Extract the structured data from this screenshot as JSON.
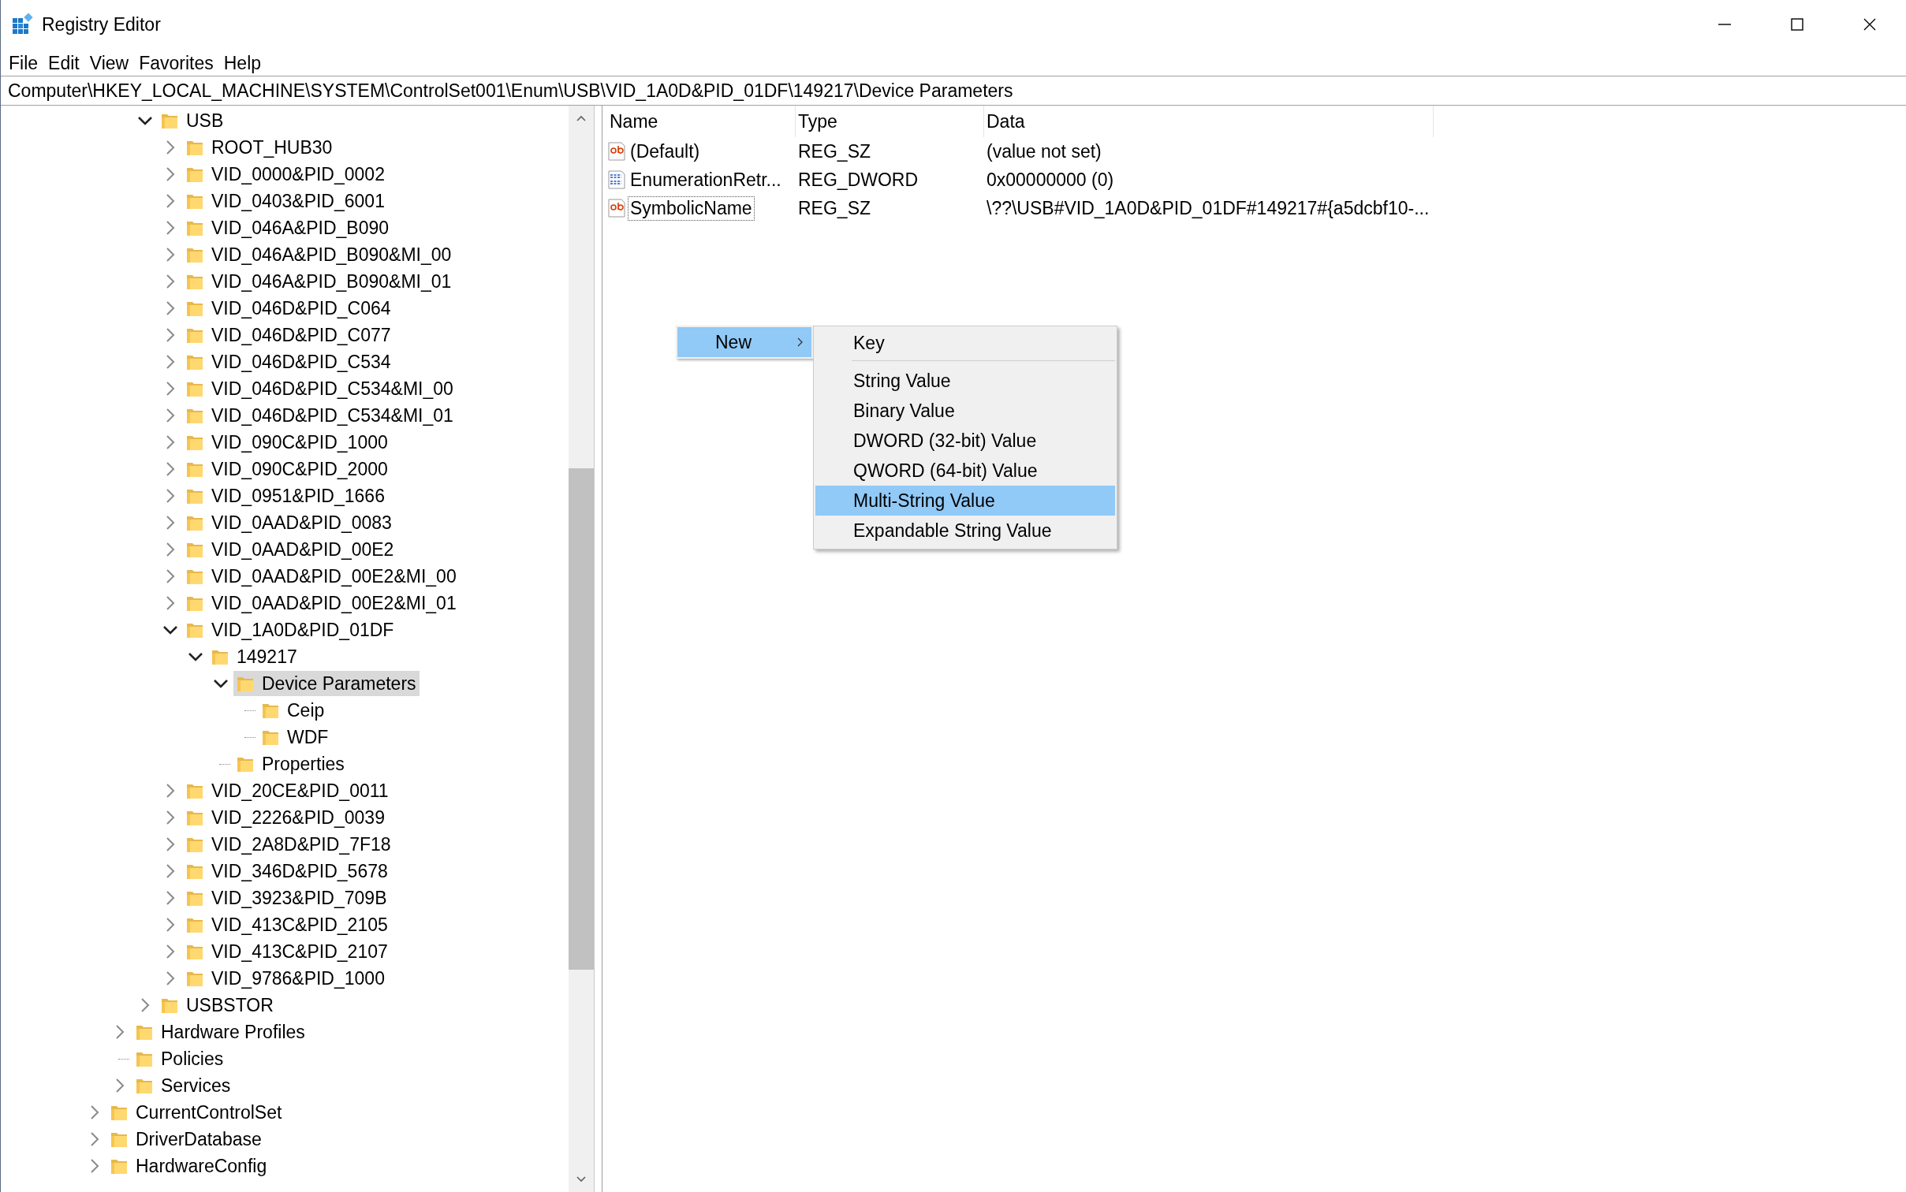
{
  "window": {
    "title": "Registry Editor"
  },
  "menu_bar": [
    "File",
    "Edit",
    "View",
    "Favorites",
    "Help"
  ],
  "address_bar": {
    "value": "Computer\\HKEY_LOCAL_MACHINE\\SYSTEM\\ControlSet001\\Enum\\USB\\VID_1A0D&PID_01DF\\149217\\Device Parameters"
  },
  "tree": {
    "items": [
      {
        "kind": "hidden",
        "children": [
          {
            "kind": "hidden",
            "children": [
              {
                "label": "USB",
                "kind": "branch",
                "expanded": true,
                "selected": false,
                "children": [
                  {
                    "label": "ROOT_HUB30",
                    "kind": "branch",
                    "expanded": false,
                    "selected": false
                  },
                  {
                    "label": "VID_0000&PID_0002",
                    "kind": "branch",
                    "expanded": false,
                    "selected": false
                  },
                  {
                    "label": "VID_0403&PID_6001",
                    "kind": "branch",
                    "expanded": false,
                    "selected": false
                  },
                  {
                    "label": "VID_046A&PID_B090",
                    "kind": "branch",
                    "expanded": false,
                    "selected": false
                  },
                  {
                    "label": "VID_046A&PID_B090&MI_00",
                    "kind": "branch",
                    "expanded": false,
                    "selected": false
                  },
                  {
                    "label": "VID_046A&PID_B090&MI_01",
                    "kind": "branch",
                    "expanded": false,
                    "selected": false
                  },
                  {
                    "label": "VID_046D&PID_C064",
                    "kind": "branch",
                    "expanded": false,
                    "selected": false
                  },
                  {
                    "label": "VID_046D&PID_C077",
                    "kind": "branch",
                    "expanded": false,
                    "selected": false
                  },
                  {
                    "label": "VID_046D&PID_C534",
                    "kind": "branch",
                    "expanded": false,
                    "selected": false
                  },
                  {
                    "label": "VID_046D&PID_C534&MI_00",
                    "kind": "branch",
                    "expanded": false,
                    "selected": false
                  },
                  {
                    "label": "VID_046D&PID_C534&MI_01",
                    "kind": "branch",
                    "expanded": false,
                    "selected": false
                  },
                  {
                    "label": "VID_090C&PID_1000",
                    "kind": "branch",
                    "expanded": false,
                    "selected": false
                  },
                  {
                    "label": "VID_090C&PID_2000",
                    "kind": "branch",
                    "expanded": false,
                    "selected": false
                  },
                  {
                    "label": "VID_0951&PID_1666",
                    "kind": "branch",
                    "expanded": false,
                    "selected": false
                  },
                  {
                    "label": "VID_0AAD&PID_0083",
                    "kind": "branch",
                    "expanded": false,
                    "selected": false
                  },
                  {
                    "label": "VID_0AAD&PID_00E2",
                    "kind": "branch",
                    "expanded": false,
                    "selected": false
                  },
                  {
                    "label": "VID_0AAD&PID_00E2&MI_00",
                    "kind": "branch",
                    "expanded": false,
                    "selected": false
                  },
                  {
                    "label": "VID_0AAD&PID_00E2&MI_01",
                    "kind": "branch",
                    "expanded": false,
                    "selected": false
                  },
                  {
                    "label": "VID_1A0D&PID_01DF",
                    "kind": "branch",
                    "expanded": true,
                    "selected": false,
                    "children": [
                      {
                        "label": "149217",
                        "kind": "branch",
                        "expanded": true,
                        "selected": false,
                        "children": [
                          {
                            "label": "Device Parameters",
                            "kind": "branch",
                            "expanded": true,
                            "selected": true,
                            "children": [
                              {
                                "label": "Ceip",
                                "kind": "leaf",
                                "selected": false
                              },
                              {
                                "label": "WDF",
                                "kind": "leaf",
                                "selected": false
                              }
                            ]
                          },
                          {
                            "label": "Properties",
                            "kind": "leaf",
                            "selected": false
                          }
                        ]
                      }
                    ]
                  },
                  {
                    "label": "VID_20CE&PID_0011",
                    "kind": "branch",
                    "expanded": false,
                    "selected": false
                  },
                  {
                    "label": "VID_2226&PID_0039",
                    "kind": "branch",
                    "expanded": false,
                    "selected": false
                  },
                  {
                    "label": "VID_2A8D&PID_7F18",
                    "kind": "branch",
                    "expanded": false,
                    "selected": false
                  },
                  {
                    "label": "VID_346D&PID_5678",
                    "kind": "branch",
                    "expanded": false,
                    "selected": false
                  },
                  {
                    "label": "VID_3923&PID_709B",
                    "kind": "branch",
                    "expanded": false,
                    "selected": false
                  },
                  {
                    "label": "VID_413C&PID_2105",
                    "kind": "branch",
                    "expanded": false,
                    "selected": false
                  },
                  {
                    "label": "VID_413C&PID_2107",
                    "kind": "branch",
                    "expanded": false,
                    "selected": false
                  },
                  {
                    "label": "VID_9786&PID_1000",
                    "kind": "branch",
                    "expanded": false,
                    "selected": false
                  }
                ]
              },
              {
                "label": "USBSTOR",
                "kind": "branch",
                "expanded": false,
                "selected": false
              }
            ]
          },
          {
            "label": "Hardware Profiles",
            "kind": "branch",
            "expanded": false,
            "selected": false
          },
          {
            "label": "Policies",
            "kind": "leaf",
            "selected": false
          },
          {
            "label": "Services",
            "kind": "branch",
            "expanded": false,
            "selected": false
          }
        ]
      },
      {
        "label": "CurrentControlSet",
        "kind": "branch",
        "expanded": false,
        "selected": false
      },
      {
        "label": "DriverDatabase",
        "kind": "branch",
        "expanded": false,
        "selected": false
      },
      {
        "label": "HardwareConfig",
        "kind": "branch",
        "expanded": false,
        "selected": false
      }
    ]
  },
  "values": {
    "columns": [
      "Name",
      "Type",
      "Data"
    ],
    "rows": [
      {
        "kind": "string",
        "name": "(Default)",
        "type": "REG_SZ",
        "data": "(value not set)",
        "focused": false
      },
      {
        "kind": "binary",
        "name": "EnumerationRetr...",
        "type": "REG_DWORD",
        "data": "0x00000000 (0)",
        "focused": false
      },
      {
        "kind": "string",
        "name": "SymbolicName",
        "type": "REG_SZ",
        "data": "\\??\\USB#VID_1A0D&PID_01DF#149217#{a5dcbf10-...",
        "focused": true
      }
    ]
  },
  "context_menu": {
    "items": [
      {
        "label": "New",
        "selected": true
      }
    ],
    "submenu": [
      {
        "kind": "item",
        "label": "Key",
        "selected": false
      },
      {
        "kind": "separator"
      },
      {
        "kind": "item",
        "label": "String Value",
        "selected": false
      },
      {
        "kind": "item",
        "label": "Binary Value",
        "selected": false
      },
      {
        "kind": "item",
        "label": "DWORD (32-bit) Value",
        "selected": false
      },
      {
        "kind": "item",
        "label": "QWORD (64-bit) Value",
        "selected": false
      },
      {
        "kind": "item",
        "label": "Multi-String Value",
        "selected": true
      },
      {
        "kind": "item",
        "label": "Expandable String Value",
        "selected": false
      }
    ]
  }
}
